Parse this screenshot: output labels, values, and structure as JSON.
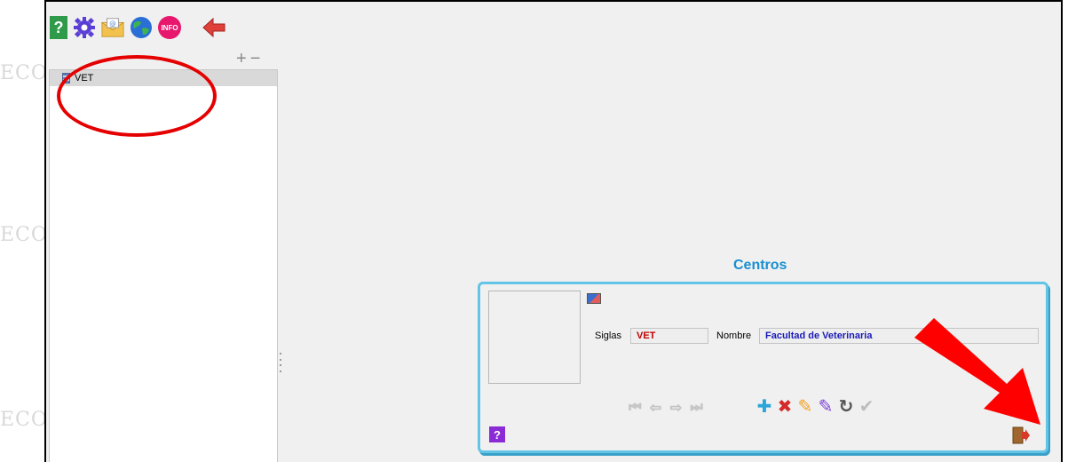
{
  "watermark": "ECO",
  "toolbar": {
    "items": [
      {
        "name": "help-icon",
        "glyph": "?"
      },
      {
        "name": "gear-icon",
        "glyph": "⚙"
      },
      {
        "name": "mail-icon",
        "glyph": "@"
      },
      {
        "name": "globe-icon",
        "glyph": "🌐"
      },
      {
        "name": "info-icon",
        "glyph": "INFO"
      },
      {
        "name": "back-arrow-icon",
        "glyph": "⬅"
      }
    ]
  },
  "tree": {
    "expand_label": "+",
    "collapse_label": "−",
    "items": [
      {
        "label": "VET"
      }
    ]
  },
  "panel": {
    "title": "Centros",
    "siglas_label": "Siglas",
    "siglas_value": "VET",
    "nombre_label": "Nombre",
    "nombre_value": "Facultad de Veterinaria",
    "help_glyph": "?"
  },
  "nav": {
    "first": "⏮",
    "prev": "⇦",
    "next": "⇨",
    "last": "⏭"
  },
  "actions": {
    "add": "✚",
    "delete": "✖",
    "edit": "✎",
    "edit_alt": "✎",
    "refresh": "↻",
    "confirm": "✔"
  },
  "colors": {
    "accent_title": "#1a8fd0",
    "panel_border": "#62c4e6",
    "annotation_red": "#e50000",
    "siglas_text": "#c00000",
    "nombre_text": "#1a1ab8"
  }
}
